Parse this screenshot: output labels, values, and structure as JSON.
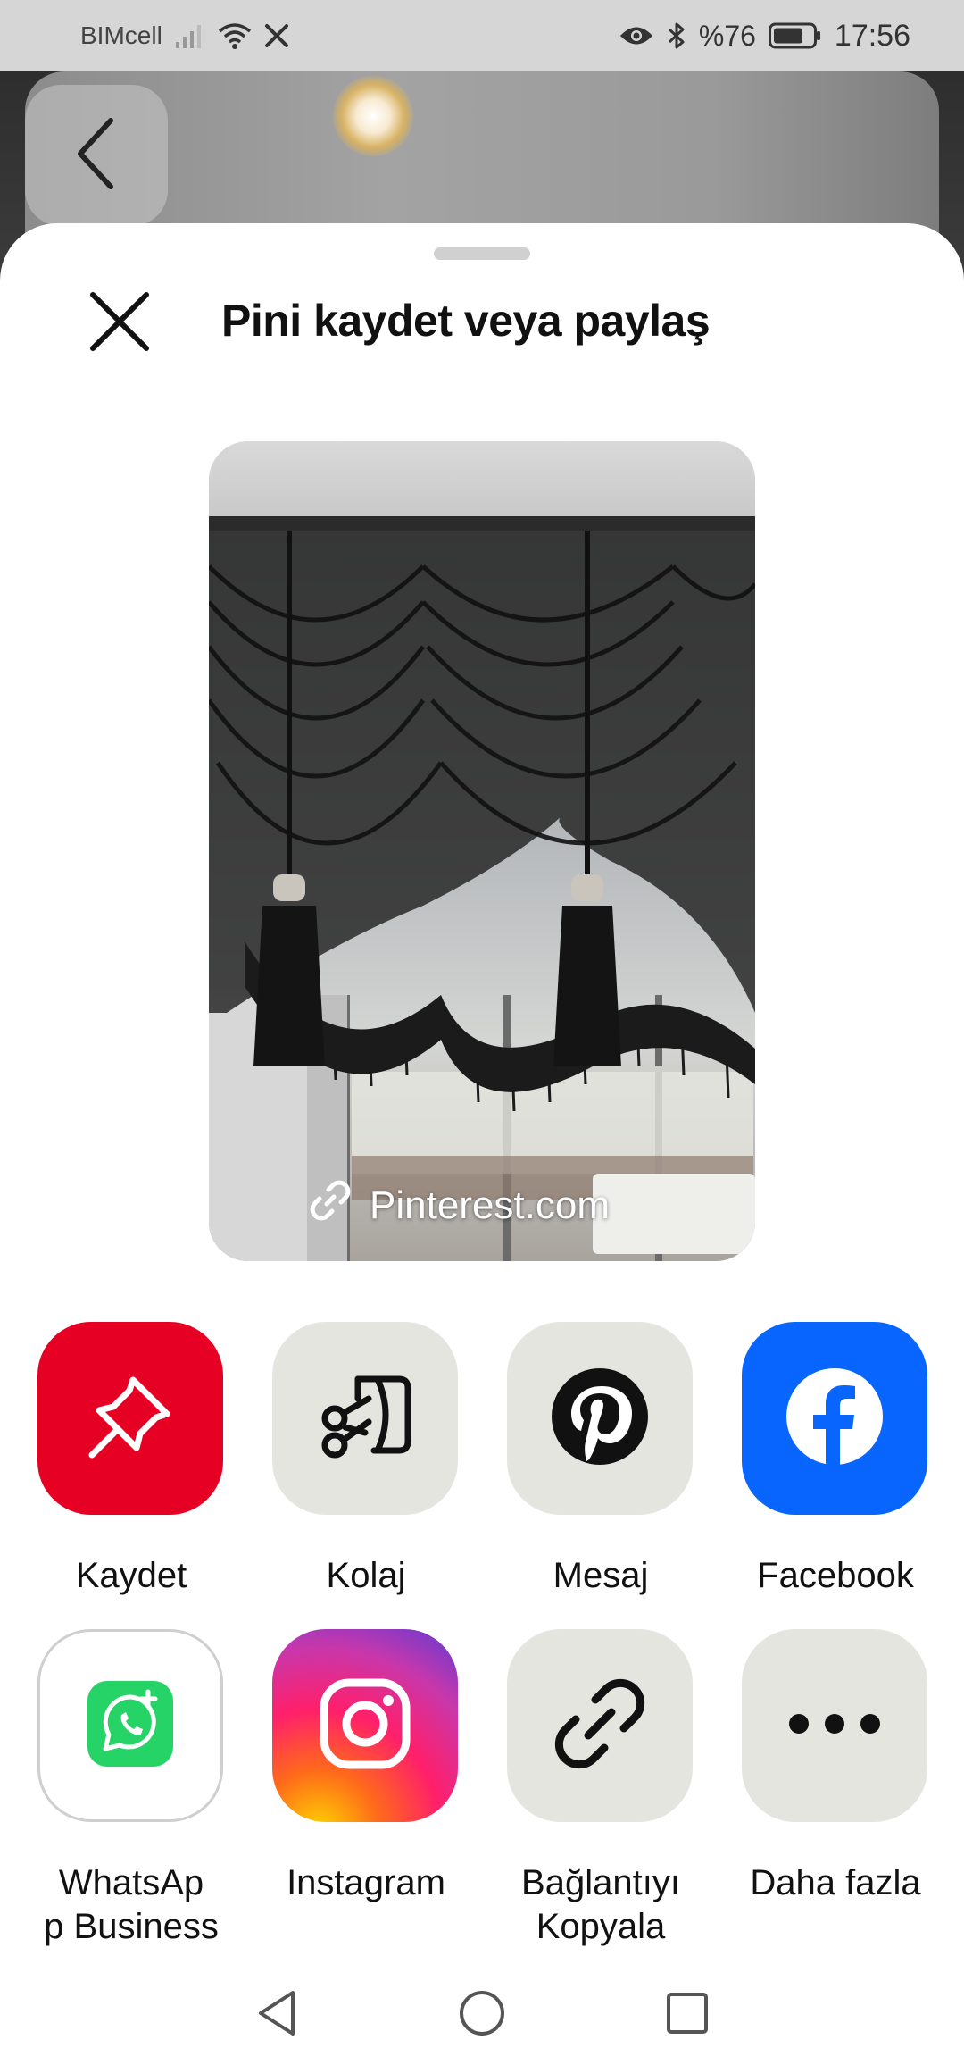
{
  "status_bar": {
    "carrier": "BIMcell",
    "battery_percent": "%76",
    "time": "17:56",
    "icons": [
      "signal-icon",
      "wifi-icon",
      "x-app-icon",
      "eye-icon",
      "bluetooth-icon",
      "battery-icon"
    ],
    "battery_level": 0.76
  },
  "sheet": {
    "title": "Pini kaydet veya paylaş",
    "close_icon": "close-icon"
  },
  "pin": {
    "source_label": "Pinterest.com",
    "source_icon": "link-icon"
  },
  "share_options": [
    {
      "label": "Kaydet",
      "icon": "pushpin-icon",
      "color": "#e60023"
    },
    {
      "label": "Kolaj",
      "icon": "collage-scissors-icon",
      "color": "#e5e5e0"
    },
    {
      "label": "Mesaj",
      "icon": "pinterest-logo-icon",
      "color": "#e5e5e0"
    },
    {
      "label": "Facebook",
      "icon": "facebook-icon",
      "color": "#0866ff"
    },
    {
      "label": "WhatsAp\np Business",
      "icon": "whatsapp-business-icon",
      "color": "#ffffff"
    },
    {
      "label": "Instagram",
      "icon": "instagram-icon",
      "color": "#e1306c"
    },
    {
      "label": "Bağlantıyı\nKopyala",
      "icon": "link-icon",
      "color": "#e5e5e0"
    },
    {
      "label": "Daha fazla",
      "icon": "more-dots-icon",
      "color": "#e5e5e0"
    }
  ],
  "nav_bar": {
    "icons": [
      "back-triangle-icon",
      "home-circle-icon",
      "recents-square-icon"
    ]
  }
}
